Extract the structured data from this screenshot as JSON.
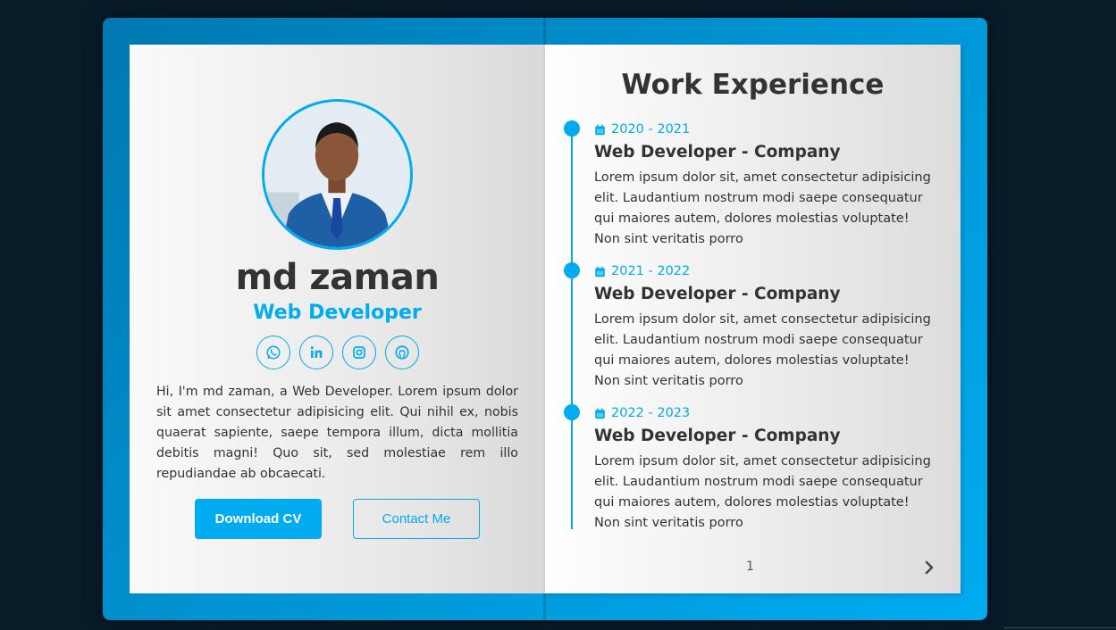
{
  "profile": {
    "name": "md zaman",
    "role": "Web Developer",
    "bio": "Hi, I'm md zaman, a Web Developer. Lorem ipsum dolor sit amet consectetur adipisicing elit. Qui nihil ex, nobis quaerat sapiente, saepe tempora illum, dicta mollitia debitis magni! Quo sit, sed molestiae rem illo repudiandae ab obcaecati.",
    "socials": [
      "whatsapp-icon",
      "linkedin-icon",
      "instagram-icon",
      "github-icon"
    ],
    "download_cv_label": "Download CV",
    "contact_me_label": "Contact Me"
  },
  "experience": {
    "title": "Work Experience",
    "entries": [
      {
        "date": "2020 - 2021",
        "title": "Web Developer - Company",
        "description": "Lorem ipsum dolor sit, amet consectetur adipisicing elit. Laudantium nostrum modi saepe consequatur qui maiores autem, dolores molestias voluptate! Non sint veritatis porro"
      },
      {
        "date": "2021 - 2022",
        "title": "Web Developer - Company",
        "description": "Lorem ipsum dolor sit, amet consectetur adipisicing elit. Laudantium nostrum modi saepe consequatur qui maiores autem, dolores molestias voluptate! Non sint veritatis porro"
      },
      {
        "date": "2022 - 2023",
        "title": "Web Developer - Company",
        "description": "Lorem ipsum dolor sit, amet consectetur adipisicing elit. Laudantium nostrum modi saepe consequatur qui maiores autem, dolores molestias voluptate! Non sint veritatis porro"
      }
    ]
  },
  "pagination": {
    "page_number": "1",
    "next_icon": "chevron-right-icon"
  },
  "colors": {
    "accent": "#00abf0",
    "background": "#081b29",
    "text": "#333333"
  }
}
